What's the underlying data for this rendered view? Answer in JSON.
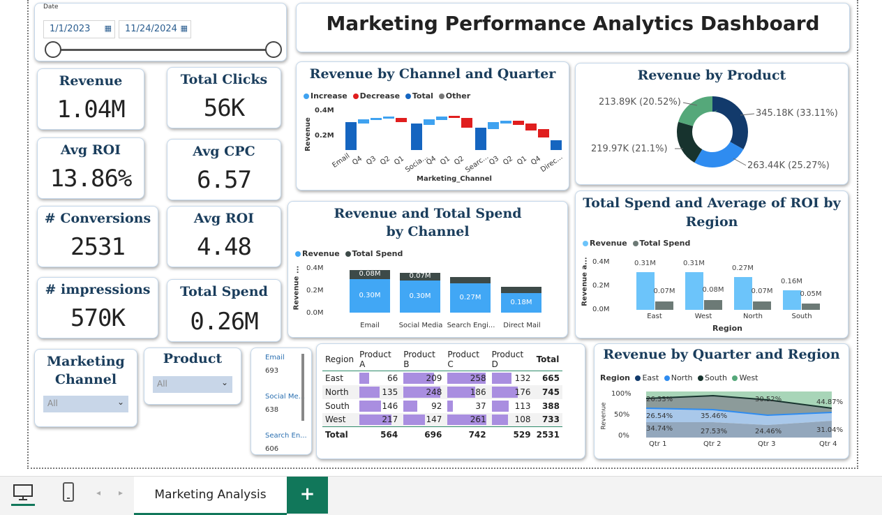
{
  "dashboard": {
    "title": "Marketing Performance Analytics Dashboard"
  },
  "date_slicer": {
    "label": "Date",
    "start": "1/1/2023",
    "end": "11/24/2024"
  },
  "kpis": [
    {
      "label": "Revenue",
      "value": "1.04M"
    },
    {
      "label": "Total Clicks",
      "value": "56K"
    },
    {
      "label": "Avg ROI",
      "value": "13.86%"
    },
    {
      "label": "Avg CPC",
      "value": "6.57"
    },
    {
      "label": "# Conversions",
      "value": "2531"
    },
    {
      "label": "Avg ROI",
      "value": "4.48"
    },
    {
      "label": "# impressions",
      "value": "570K"
    },
    {
      "label": "Total Spend",
      "value": "0.26M"
    }
  ],
  "waterfall": {
    "title": "Revenue by Channel and Quarter",
    "legend": [
      "Increase",
      "Decrease",
      "Total",
      "Other"
    ],
    "colors": {
      "increase": "#3fa2f0",
      "decrease": "#e01e1e",
      "total": "#1565c0",
      "other": "#777777"
    },
    "ylabel": "Revenue",
    "xlabel": "Marketing_Channel",
    "yticks": [
      "0.4M",
      "0.2M"
    ],
    "xticks": [
      "Email",
      "Q4",
      "Q3",
      "Q2",
      "Q1",
      "Socia...",
      "Q4",
      "Q1",
      "Q2",
      "Searc...",
      "Q3",
      "Q2",
      "Q1",
      "Q4",
      "Direc..."
    ]
  },
  "product_donut": {
    "title": "Revenue by Product",
    "slices": [
      {
        "label": "345.18K (33.11%)",
        "value": 33.11,
        "color": "#123a6b"
      },
      {
        "label": "263.44K (25.27%)",
        "value": 25.27,
        "color": "#2f8cf0"
      },
      {
        "label": "219.97K (21.1%)",
        "value": 21.1,
        "color": "#17332e"
      },
      {
        "label": "213.89K (20.52%)",
        "value": 20.52,
        "color": "#55a87a"
      }
    ]
  },
  "channel_bars": {
    "title": "Revenue and Total Spend by Channel",
    "legend": [
      "Revenue",
      "Total Spend"
    ],
    "ylabel": "Revenue ...",
    "yticks": [
      "0.4M",
      "0.2M",
      "0.0M"
    ],
    "categories": [
      "Email",
      "Social Media",
      "Search Engi...",
      "Direct Mail"
    ],
    "revenue": [
      0.3,
      0.3,
      0.27,
      0.18
    ],
    "spend": [
      0.08,
      0.07,
      0.06,
      0.05
    ],
    "revenue_labels": [
      "0.30M",
      "0.30M",
      "0.27M",
      "0.18M"
    ],
    "spend_labels": [
      "0.08M",
      "0.07M",
      "",
      ""
    ],
    "colors": {
      "revenue": "#41a7f5",
      "spend": "#3d4a48"
    }
  },
  "region_bars": {
    "title": "Total Spend and Average of ROI by Region",
    "legend": [
      "Revenue",
      "Total Spend"
    ],
    "ylabel": "Revenue a...",
    "xlabel": "Region",
    "yticks": [
      "0.4M",
      "0.2M",
      "0.0M"
    ],
    "categories": [
      "East",
      "West",
      "North",
      "South"
    ],
    "revenue": [
      0.31,
      0.31,
      0.27,
      0.16
    ],
    "spend": [
      0.07,
      0.08,
      0.07,
      0.05
    ],
    "revenue_labels": [
      "0.31M",
      "0.31M",
      "0.27M",
      "0.16M"
    ],
    "spend_labels": [
      "0.07M",
      "0.08M",
      "0.07M",
      "0.05M"
    ],
    "colors": {
      "revenue": "#6cc4fa",
      "spend": "#6c7a76"
    }
  },
  "slicers": {
    "channel": {
      "label": "Marketing Channel",
      "value": "All"
    },
    "product": {
      "label": "Product",
      "value": "All"
    }
  },
  "channel_list": [
    {
      "name": "Email",
      "value": "693"
    },
    {
      "name": "Social Me...",
      "value": "638"
    },
    {
      "name": "Search En...",
      "value": "606"
    }
  ],
  "matrix": {
    "headers": [
      "Region",
      "Product A",
      "Product B",
      "Product C",
      "Product D",
      "Total"
    ],
    "rows": [
      {
        "region": "East",
        "values": [
          66,
          209,
          258,
          132
        ],
        "total": 665
      },
      {
        "region": "North",
        "values": [
          135,
          248,
          186,
          176
        ],
        "total": 745
      },
      {
        "region": "South",
        "values": [
          146,
          92,
          37,
          113
        ],
        "total": 388
      },
      {
        "region": "West",
        "values": [
          217,
          147,
          261,
          108
        ],
        "total": 733
      }
    ],
    "total_row": {
      "label": "Total",
      "values": [
        564,
        696,
        742,
        529
      ],
      "total": 2531
    },
    "bar_max": 261
  },
  "area_chart": {
    "title": "Revenue by Quarter and Region",
    "legend_title": "Region",
    "legend": [
      {
        "name": "East",
        "color": "#123a6b"
      },
      {
        "name": "North",
        "color": "#2f8cf0"
      },
      {
        "name": "South",
        "color": "#17332e"
      },
      {
        "name": "West",
        "color": "#55a87a"
      }
    ],
    "ylabel": "Revenue",
    "yticks": [
      "100%",
      "50%",
      "0%"
    ],
    "xticks": [
      "Qtr 1",
      "Qtr 2",
      "Qtr 3",
      "Qtr 4"
    ],
    "labels": {
      "top": [
        "26.33%",
        "30.52%",
        "44.87%"
      ],
      "mid": [
        "26.54%",
        "35.46%"
      ],
      "bottom": [
        "34.74%",
        "27.53%",
        "24.46%",
        "31.04%"
      ]
    }
  },
  "tabs": {
    "active": "Marketing Analysis",
    "add": "+"
  }
}
